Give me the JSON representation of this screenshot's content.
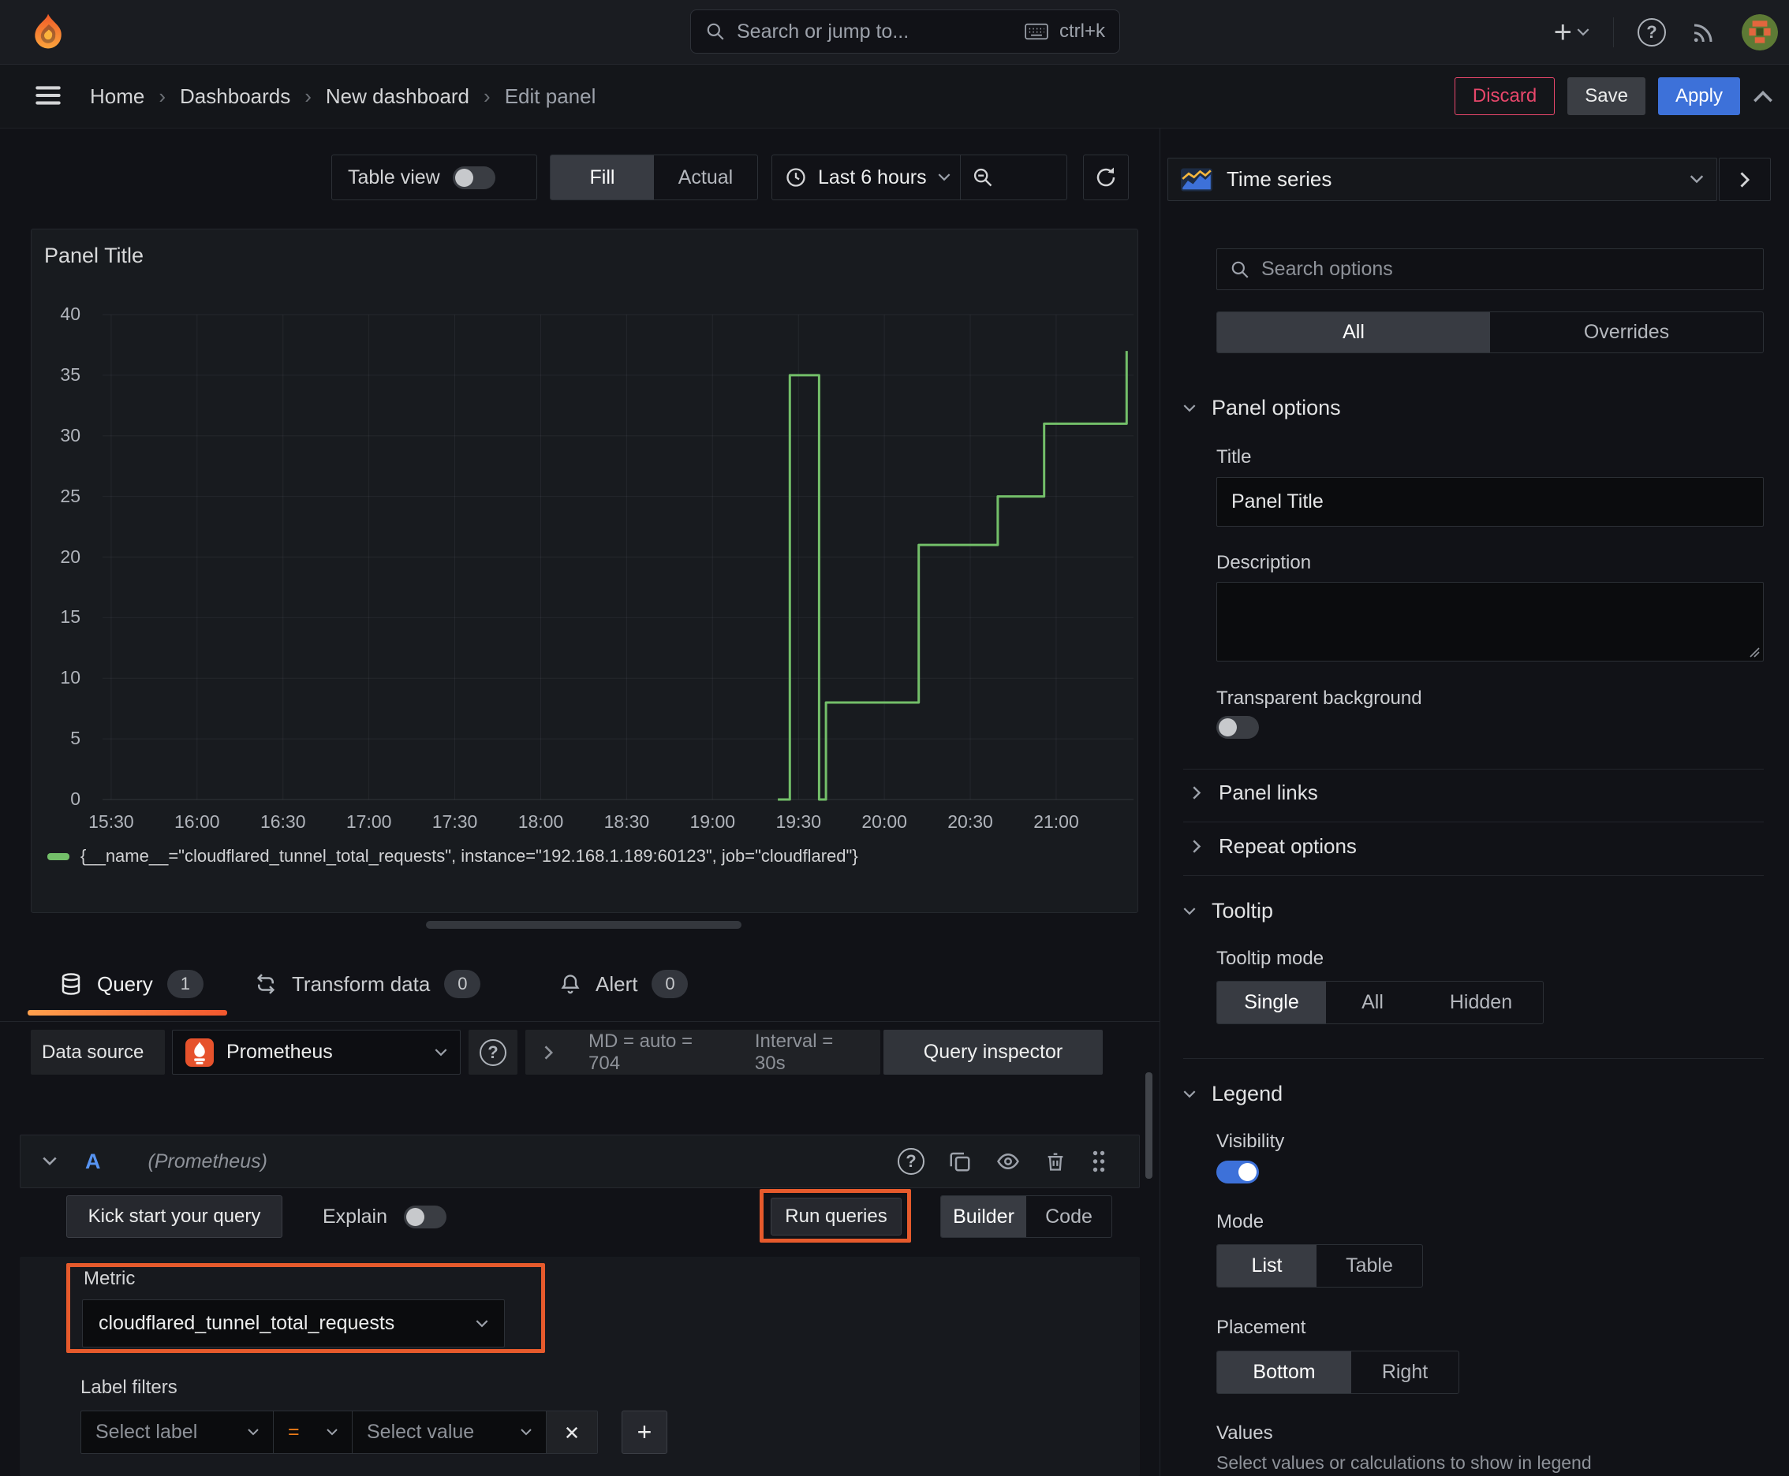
{
  "topbar": {
    "search": {
      "placeholder": "Search or jump to...",
      "shortcut": "ctrl+k"
    }
  },
  "breadcrumb": {
    "items": [
      "Home",
      "Dashboards",
      "New dashboard",
      "Edit panel"
    ],
    "actions": {
      "discard": "Discard",
      "save": "Save",
      "apply": "Apply"
    }
  },
  "panel_toolbar": {
    "table_view": "Table view",
    "fill": "Fill",
    "actual": "Actual",
    "time_range": "Last 6 hours"
  },
  "chart_data": {
    "type": "line",
    "line_style": "step-after",
    "title": "Panel Title",
    "color": "#73bf69",
    "grid": true,
    "ylim": [
      0,
      40
    ],
    "y_ticks": [
      0,
      5,
      10,
      15,
      20,
      25,
      30,
      35,
      40
    ],
    "x_domain_hours": [
      15.45,
      21.45
    ],
    "x_ticks": [
      "15:30",
      "16:00",
      "16:30",
      "17:00",
      "17:30",
      "18:00",
      "18:30",
      "19:00",
      "19:30",
      "20:00",
      "20:30",
      "21:00"
    ],
    "x_tick_hours": [
      15.5,
      16,
      16.5,
      17,
      17.5,
      18,
      18.5,
      19,
      19.5,
      20,
      20.5,
      21
    ],
    "series": [
      {
        "name": "cloudflared_tunnel_total_requests",
        "points": [
          [
            19.38,
            0
          ],
          [
            19.45,
            0
          ],
          [
            19.45,
            35
          ],
          [
            19.62,
            35
          ],
          [
            19.62,
            0
          ],
          [
            19.66,
            0
          ],
          [
            19.66,
            8
          ],
          [
            20.2,
            8
          ],
          [
            20.2,
            21
          ],
          [
            20.66,
            21
          ],
          [
            20.66,
            25
          ],
          [
            20.93,
            25
          ],
          [
            20.93,
            31
          ],
          [
            21.41,
            31
          ],
          [
            21.41,
            37
          ]
        ]
      }
    ],
    "legend": [
      {
        "label": "{__name__=\"cloudflared_tunnel_total_requests\", instance=\"192.168.1.189:60123\", job=\"cloudflared\"}",
        "color": "#73bf69"
      }
    ],
    "legend_position": "bottom"
  },
  "tabs": {
    "query": {
      "label": "Query",
      "count": "1"
    },
    "transform": {
      "label": "Transform data",
      "count": "0"
    },
    "alert": {
      "label": "Alert",
      "count": "0"
    }
  },
  "datasource_row": {
    "label": "Data source",
    "name": "Prometheus",
    "max_data_points": "MD = auto = 704",
    "interval": "Interval = 30s",
    "inspector": "Query inspector"
  },
  "query_editor": {
    "ref_id": "A",
    "ds_hint": "(Prometheus)",
    "kick_start": "Kick start your query",
    "explain": "Explain",
    "run_queries": "Run queries",
    "builder": "Builder",
    "code": "Code",
    "metric": {
      "label": "Metric",
      "value": "cloudflared_tunnel_total_requests"
    },
    "label_filters": {
      "label": "Label filters",
      "select_label": "Select label",
      "operator": "=",
      "select_value": "Select value"
    }
  },
  "sidebar": {
    "visualization": "Time series",
    "search_placeholder": "Search options",
    "tabs": {
      "all": "All",
      "overrides": "Overrides"
    },
    "panel_options": {
      "title": "Panel options",
      "title_label": "Title",
      "title_value": "Panel Title",
      "description_label": "Description",
      "transparent_label": "Transparent background",
      "panel_links": "Panel links",
      "repeat_options": "Repeat options"
    },
    "tooltip": {
      "title": "Tooltip",
      "mode_label": "Tooltip mode",
      "options": [
        "Single",
        "All",
        "Hidden"
      ],
      "selected": "Single"
    },
    "legend": {
      "title": "Legend",
      "visibility_label": "Visibility",
      "visibility_on": true,
      "mode_label": "Mode",
      "mode_options": [
        "List",
        "Table"
      ],
      "mode_selected": "List",
      "placement_label": "Placement",
      "placement_options": [
        "Bottom",
        "Right"
      ],
      "placement_selected": "Bottom",
      "values_label": "Values",
      "values_hint": "Select values or calculations to show in legend"
    }
  },
  "colors": {
    "accent_blue": "#3d71d9",
    "series_green": "#73bf69",
    "annotation_orange": "#e65a2c",
    "discard_pink": "#e8476b",
    "tab_underline": "#f2572e"
  }
}
